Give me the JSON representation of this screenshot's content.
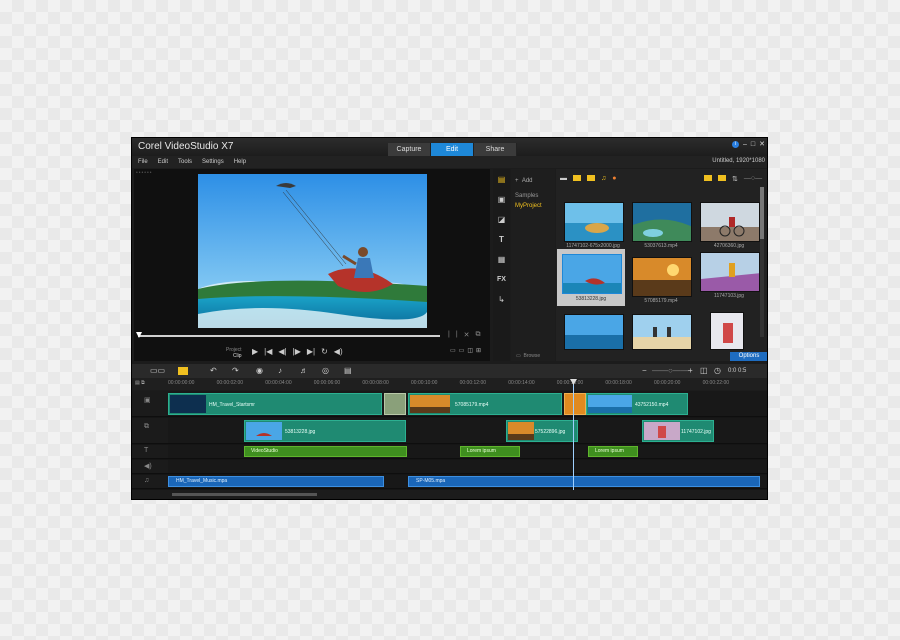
{
  "app": {
    "title": "Corel VideoStudio X7",
    "tabs": [
      "Capture",
      "Edit",
      "Share"
    ],
    "active_tab": "Edit",
    "project_info": "Untitled, 1920*1080",
    "info_icon": "i",
    "win_min": "–",
    "win_max": "□",
    "win_close": "✕"
  },
  "menu": [
    "File",
    "Edit",
    "Tools",
    "Settings",
    "Help"
  ],
  "player": {
    "dots": "••••••",
    "project_label": "Project",
    "clip_label": "Clip",
    "transport": [
      "▶",
      "|◀",
      "◀|",
      "|▶",
      "▶|",
      "↻",
      "◀)"
    ],
    "right_ctrls": [
      "|",
      "|",
      "✕",
      "⧉"
    ],
    "tc_ctrls": [
      "▭",
      "▭",
      "◫",
      "⊞"
    ]
  },
  "library": {
    "add_label": "Add",
    "folders": [
      "Samples",
      "MyProject"
    ],
    "selected_folder": "MyProject",
    "browse_label": "Browse",
    "options_label": "Options",
    "thumbs": [
      {
        "label": "11747102-675x2000.jpg"
      },
      {
        "label": "53037613.mp4"
      },
      {
        "label": "42706360.jpg"
      },
      {
        "label": "53813228.jpg"
      },
      {
        "label": "57085179.mp4"
      },
      {
        "label": "11747103.jpg"
      },
      {
        "label": "",
        "selected": false
      },
      {
        "label": ""
      },
      {
        "label": ""
      }
    ],
    "tool_icons": [
      "media-icon",
      "instant-project-icon",
      "title-icon",
      "transition-icon",
      "fx-icon",
      "path-icon"
    ]
  },
  "timeline": {
    "ticks": [
      "00:00:00:00",
      "00:00:02:00",
      "00:00:04:00",
      "00:00:06:00",
      "00:00:08:00",
      "00:00:10:00",
      "00:00:12:00",
      "00:00:14:00",
      "00:00:16:00",
      "00:00:18:00",
      "00:00:20:00",
      "00:00:22:00"
    ],
    "zoom_label": "0:0 0:5",
    "video_clips": [
      {
        "label": "HM_Travel_Startsmr"
      },
      {
        "label": "57085179.mp4"
      },
      {
        "label": "43752150.mp4"
      }
    ],
    "overlay_clips": [
      {
        "label": "53813228.jpg"
      },
      {
        "label": "57522896.jpg"
      },
      {
        "label": "11747102.jpg"
      }
    ],
    "title_clips": [
      {
        "label": "VideoStudio"
      },
      {
        "label": "Lorem ipsum"
      },
      {
        "label": "Lorem ipsum"
      }
    ],
    "music_clips": [
      {
        "label": "HM_Travel_Music.mpa"
      },
      {
        "label": "SP-M05.mpa"
      }
    ],
    "track_icons": [
      "video-track-icon",
      "overlay-track-icon",
      "title-track-icon",
      "voice-track-icon",
      "music-track-icon"
    ]
  },
  "colors": {
    "accent": "#1e88d8",
    "clip": "#1f8a72",
    "title": "#3f8f1f",
    "music": "#1a66b8",
    "folder": "#f0c020"
  }
}
